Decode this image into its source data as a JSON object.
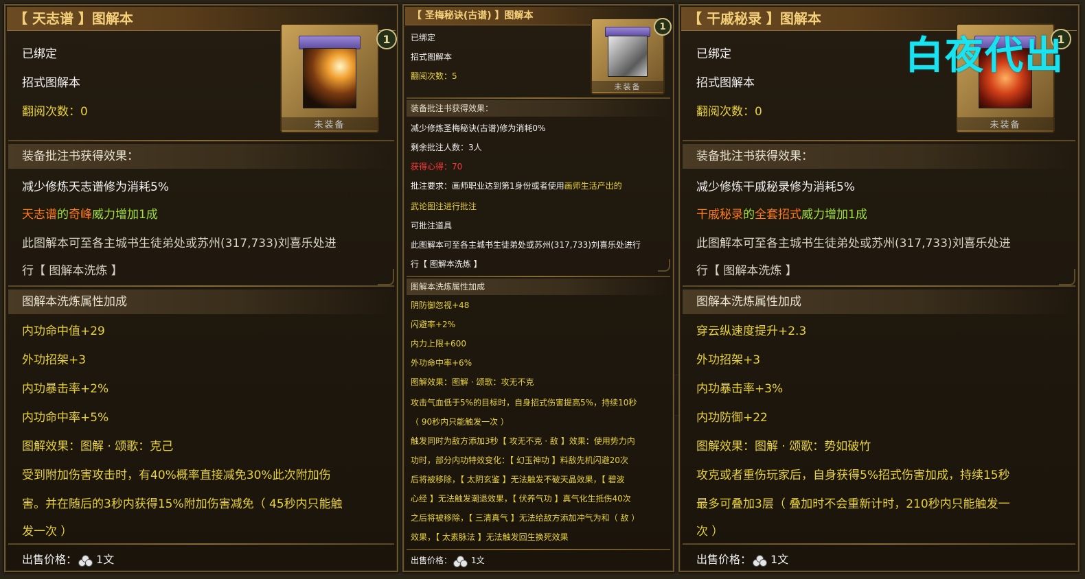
{
  "panel_left": {
    "title": "【 天志谱 】图解本",
    "badge": "1",
    "item_icon": "spear-icon",
    "unequipped": "未装备",
    "bound": "已绑定",
    "type": "招式图解本",
    "read_count": "翻阅次数：0",
    "annot_header": "装备批注书获得效果：",
    "annot_reduce": "减少修炼天志谱修为消耗5%",
    "power_a": "天志谱",
    "power_b": "的",
    "power_c": "奇峰",
    "power_d": "威力增加1成",
    "note_1": "此图解本可至各主城书生徒弟处或苏州(317,733)刘喜乐处进",
    "note_2": "行【 图解本洗炼 】",
    "refine_header": "图解本洗炼属性加成",
    "attrs": [
      "内功命中值+29",
      "外功招架+3",
      "内功暴击率+2%",
      "内功命中率+5%"
    ],
    "effect_title": "图解效果：图解 · 颂歌：克己",
    "effect_desc": [
      "受到附加伤害攻击时，有40%概率直接减免30%此次附加伤",
      "害。并在随后的3秒内获得15%附加伤害减免（ 45秒内只能触",
      "发一次 ）"
    ],
    "sell_label": "出售价格：",
    "sell_value": "1文"
  },
  "panel_middle": {
    "title": "【 圣梅秘诀(古谱) 】图解本",
    "badge": "1",
    "item_icon": "crystal-box-icon",
    "unequipped": "未装备",
    "bound": "已绑定",
    "type": "招式图解本",
    "read_count": "翻阅次数：5",
    "annot_header": "装备批注书获得效果：",
    "annot_reduce": "减少修炼圣梅秘诀(古谱)修为消耗0%",
    "remaining": "剩余批注人数：3人",
    "insight": "获得心得：70",
    "req_a": "批注要求：画师职业达到第1身份或者使用",
    "req_b": "画师生活产出的",
    "req_2": "武论图注进行批注",
    "tool": "可批注道具",
    "note_1": "此图解本可至各主城书生徒弟处或苏州(317,733)刘喜乐处进行",
    "note_2": "行【 图解本洗炼 】",
    "refine_header": "图解本洗炼属性加成",
    "attrs": [
      "阴防御忽视+48",
      "闪避率+2%",
      "内力上限+600",
      "外功命中率+6%"
    ],
    "effect_title": "图解效果：图解 · 颂歌：攻无不克",
    "effect_desc": [
      "攻击气血低于5%的目标时，自身招式伤害提高5%，持续10秒",
      "（ 90秒内只能触发一次 ）",
      "触发同时为敌方添加3秒【 攻无不克 · 敌 】效果：使用势力内",
      "功时，部分内功特效变化：【 幻玉神功 】料敌先机闪避20次",
      "后将被移除，【 太阴玄鉴 】无法触发不破天晶效果，【 碧波",
      "心经 】无法触发潮退效果，【 伏养气功 】真气化生抵伤40次",
      "之后将被移除，【 三清真气 】无法给敌方添加冲气为和（ 敌 ）",
      "效果，【 太素脉法 】无法触发回生换死效果"
    ],
    "sell_label": "出售价格：",
    "sell_value": "1文"
  },
  "panel_right": {
    "title": "【 干戚秘录 】图解本",
    "badge": "1",
    "item_icon": "warrior-icon",
    "unequipped": "未装备",
    "bound": "已绑定",
    "type": "招式图解本",
    "read_count": "翻阅次数：0",
    "annot_header": "装备批注书获得效果：",
    "annot_reduce": "减少修炼干戚秘录修为消耗5%",
    "power_a": "干戚秘录",
    "power_b": "的",
    "power_c": "全套招式",
    "power_d": "威力增加1成",
    "note_1": "此图解本可至各主城书生徒弟处或苏州(317,733)刘喜乐处进",
    "note_2": "行【 图解本洗炼 】",
    "refine_header": "图解本洗炼属性加成",
    "attrs": [
      "穿云纵速度提升+2.3",
      "外功招架+3",
      "内功暴击率+3%",
      "内功防御+22"
    ],
    "effect_title": "图解效果：图解 · 颂歌：势如破竹",
    "effect_desc": [
      "攻克或者重伤玩家后，自身获得5%招式伤害加成，持续15秒",
      "最多可叠加3层（ 叠加时不会重新计时，210秒内只能触发一",
      "次 ）"
    ],
    "sell_label": "出售价格：",
    "sell_value": "1文"
  },
  "watermark": "白夜代出",
  "colors": {
    "title": "#f4d07a",
    "yellow_text": "#e8d23a",
    "orange_text": "#ff7a1a",
    "green_text": "#9fe03a",
    "red_text": "#ff3a3a",
    "watermark": "#19e3f0",
    "panel_border": "#6b5530"
  }
}
